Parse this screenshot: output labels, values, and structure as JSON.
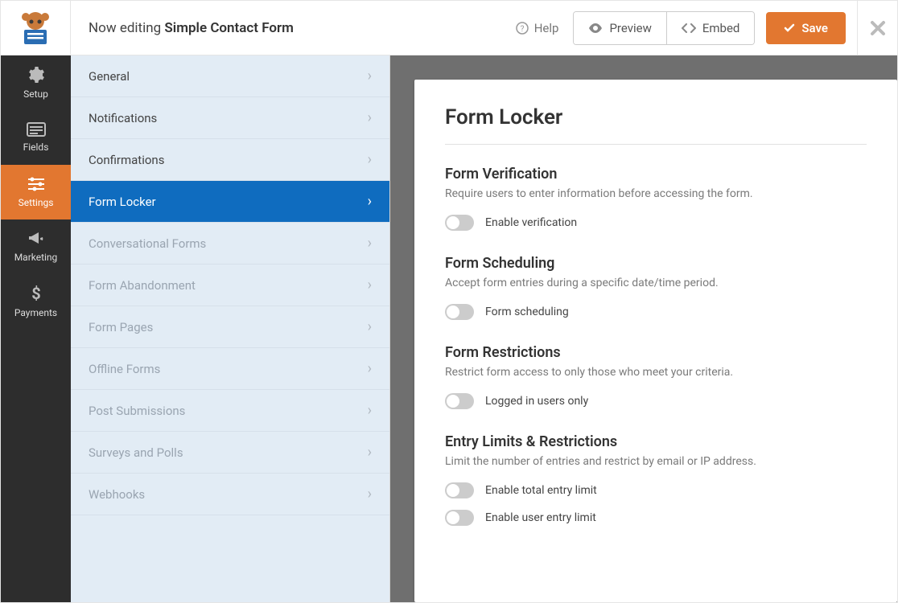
{
  "topbar": {
    "editing_prefix": "Now editing ",
    "editing_title": "Simple Contact Form",
    "help_label": "Help",
    "preview_label": "Preview",
    "embed_label": "Embed",
    "save_label": "Save"
  },
  "rail": {
    "items": [
      {
        "label": "Setup"
      },
      {
        "label": "Fields"
      },
      {
        "label": "Settings"
      },
      {
        "label": "Marketing"
      },
      {
        "label": "Payments"
      }
    ]
  },
  "panel": {
    "items": [
      {
        "label": "General",
        "muted": false
      },
      {
        "label": "Notifications",
        "muted": false
      },
      {
        "label": "Confirmations",
        "muted": false
      },
      {
        "label": "Form Locker",
        "muted": false,
        "active": true
      },
      {
        "label": "Conversational Forms",
        "muted": true
      },
      {
        "label": "Form Abandonment",
        "muted": true
      },
      {
        "label": "Form Pages",
        "muted": true
      },
      {
        "label": "Offline Forms",
        "muted": true
      },
      {
        "label": "Post Submissions",
        "muted": true
      },
      {
        "label": "Surveys and Polls",
        "muted": true
      },
      {
        "label": "Webhooks",
        "muted": true
      }
    ]
  },
  "content": {
    "title": "Form Locker",
    "sections": [
      {
        "title": "Form Verification",
        "desc": "Require users to enter information before accessing the form.",
        "toggles": [
          {
            "label": "Enable verification"
          }
        ]
      },
      {
        "title": "Form Scheduling",
        "desc": "Accept form entries during a specific date/time period.",
        "toggles": [
          {
            "label": "Form scheduling"
          }
        ]
      },
      {
        "title": "Form Restrictions",
        "desc": "Restrict form access to only those who meet your criteria.",
        "toggles": [
          {
            "label": "Logged in users only"
          }
        ]
      },
      {
        "title": "Entry Limits & Restrictions",
        "desc": "Limit the number of entries and restrict by email or IP address.",
        "toggles": [
          {
            "label": "Enable total entry limit"
          },
          {
            "label": "Enable user entry limit"
          }
        ]
      }
    ]
  }
}
